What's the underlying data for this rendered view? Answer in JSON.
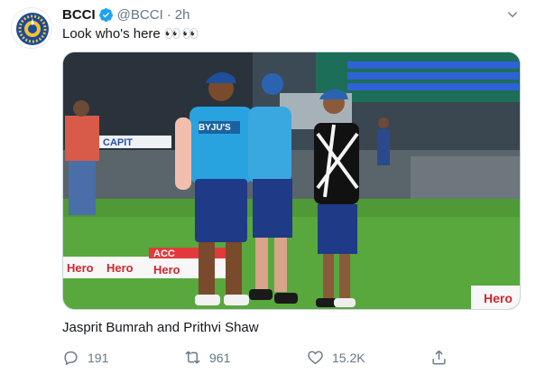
{
  "tweet": {
    "author_name": "BCCI",
    "author_handle": "@BCCI",
    "separator": "·",
    "time": "2h",
    "text": "Look who's here",
    "text_emoji": "👀👀",
    "image_caption": "Jasprit Bumrah and Prithvi Shaw",
    "image_signs": {
      "capital": "CAPIT",
      "acc": "ACC",
      "hero": "Hero",
      "jersey": "BYJU'S"
    },
    "stats": {
      "replies": "191",
      "retweets": "961",
      "likes": "15.2K"
    }
  },
  "colors": {
    "text_primary": "#14171a",
    "text_secondary": "#657786",
    "verified_blue": "#1da1f2",
    "jersey_blue": "#29a3e0",
    "grass_green": "#58a83d"
  },
  "icons": {
    "verified": "verified-badge-icon",
    "more": "chevron-down-icon",
    "reply": "reply-icon",
    "retweet": "retweet-icon",
    "like": "heart-icon",
    "share": "share-icon"
  }
}
